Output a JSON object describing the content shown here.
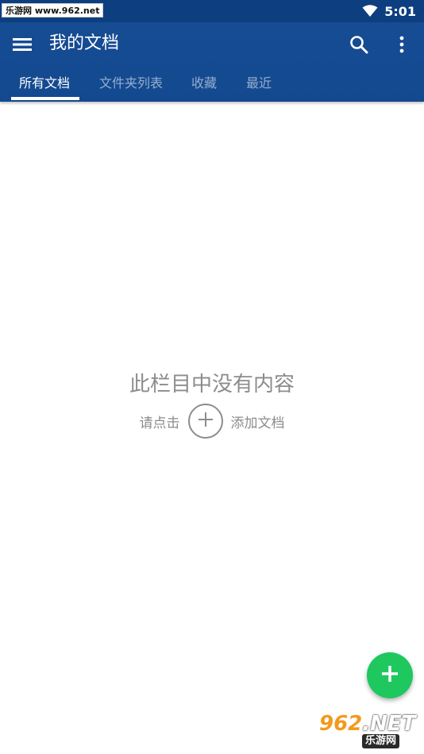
{
  "status_bar": {
    "watermark": "乐游网 www.962.net",
    "time": "5:01",
    "wifi_icon": "wifi-icon"
  },
  "app_bar": {
    "title": "我的文档",
    "menu_icon": "hamburger-menu-icon",
    "search_icon": "search-icon",
    "more_icon": "more-vertical-icon",
    "background": "#13498f"
  },
  "tabs": [
    {
      "label": "所有文档",
      "active": true
    },
    {
      "label": "文件夹列表",
      "active": false
    },
    {
      "label": "收藏",
      "active": false
    },
    {
      "label": "最近",
      "active": false
    }
  ],
  "empty_state": {
    "title": "此栏目中没有内容",
    "hint_before": "请点击",
    "hint_after": "添加文档",
    "add_icon": "plus-icon"
  },
  "fab": {
    "icon": "plus-icon",
    "color": "#1ec85f"
  },
  "watermark_bottom": {
    "number": "962",
    "suffix": ".NET",
    "site": "乐游网"
  }
}
